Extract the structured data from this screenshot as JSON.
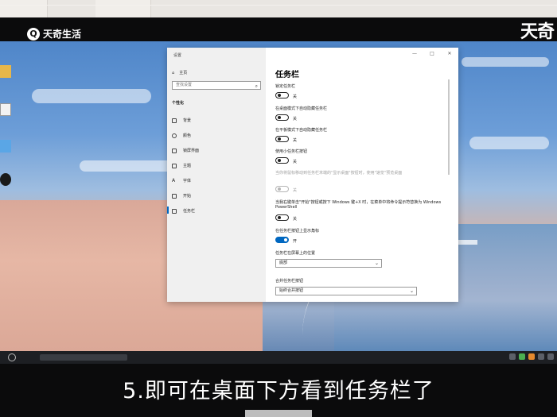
{
  "watermark": {
    "icon": "search-icon",
    "text": "天奇生活"
  },
  "brand_right": "天奇",
  "subtitle": "5.即可在桌面下方看到任务栏了",
  "window": {
    "title": "设置",
    "controls": {
      "minimize": "—",
      "maximize": "□",
      "close": "✕"
    }
  },
  "nav": {
    "home": "主页",
    "search_placeholder": "查找设置",
    "section": "个性化",
    "items": [
      {
        "label": "背景",
        "icon": "image-icon"
      },
      {
        "label": "颜色",
        "icon": "palette-icon"
      },
      {
        "label": "锁屏界面",
        "icon": "lockscreen-icon"
      },
      {
        "label": "主题",
        "icon": "theme-icon"
      },
      {
        "label": "字体",
        "icon": "font-icon"
      },
      {
        "label": "开始",
        "icon": "start-icon"
      },
      {
        "label": "任务栏",
        "icon": "taskbar-icon"
      }
    ]
  },
  "content": {
    "title": "任务栏",
    "options": [
      {
        "label": "锁定任务栏",
        "state": "关",
        "on": false,
        "disabled": false
      },
      {
        "label": "在桌面模式下自动隐藏任务栏",
        "state": "关",
        "on": false,
        "disabled": false
      },
      {
        "label": "在平板模式下自动隐藏任务栏",
        "state": "关",
        "on": false,
        "disabled": false
      },
      {
        "label": "使用小任务栏按钮",
        "state": "关",
        "on": false,
        "disabled": false
      },
      {
        "label": "当你将鼠标移动到任务栏末端的\"显示桌面\"按钮时，使用\"速览\"预览桌面",
        "state": "关",
        "on": false,
        "disabled": true
      },
      {
        "label": "当我右键单击\"开始\"按钮或按下 Windows 键+X 时，在菜单中将命令提示符替换为 Windows PowerShell",
        "state": "关",
        "on": false,
        "disabled": false
      },
      {
        "label": "在任务栏按钮上显示角标",
        "state": "开",
        "on": true,
        "disabled": false
      }
    ],
    "position_label": "任务栏在屏幕上的位置",
    "position_value": "底部",
    "combine_label": "合并任务栏按钮",
    "combine_value": "始终合并按钮"
  }
}
